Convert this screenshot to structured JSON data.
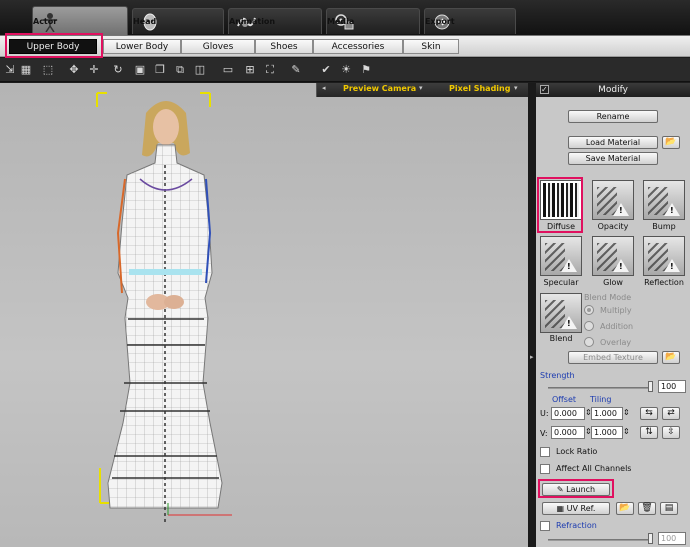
{
  "main_tabs": [
    {
      "label": "Actor",
      "icon": "actor-figure-icon",
      "active": true
    },
    {
      "label": "Head",
      "icon": "head-icon"
    },
    {
      "label": "Animation",
      "icon": "animation-icon"
    },
    {
      "label": "Media",
      "icon": "media-icon"
    },
    {
      "label": "Export",
      "icon": "export-icon"
    }
  ],
  "sub_tabs": [
    {
      "label": "Upper Body",
      "active": true
    },
    {
      "label": "Lower Body"
    },
    {
      "label": "Gloves"
    },
    {
      "label": "Shoes"
    },
    {
      "label": "Accessories"
    },
    {
      "label": "Skin"
    }
  ],
  "viewport": {
    "camera": "Preview Camera",
    "shading": "Pixel Shading"
  },
  "panel": {
    "title": "Modify",
    "rename": "Rename",
    "load_material": "Load Material",
    "save_material": "Save Material",
    "channels": [
      "Diffuse",
      "Opacity",
      "Bump",
      "Specular",
      "Glow",
      "Reflection",
      "Blend"
    ],
    "blend_mode_label": "Blend Mode",
    "blend_modes": [
      "Multiply",
      "Addition",
      "Overlay"
    ],
    "embed_texture": "Embed Texture",
    "strength_label": "Strength",
    "strength_value": "100",
    "offset_label": "Offset",
    "tiling_label": "Tiling",
    "u_label": "U:",
    "v_label": "V:",
    "u_offset": "0.000",
    "u_tiling": "1.000",
    "v_offset": "0.000",
    "v_tiling": "1.000",
    "lock_ratio": "Lock Ratio",
    "affect_all": "Affect All Channels",
    "launch": "Launch",
    "uv_ref": "UV Ref.",
    "refraction": "Refraction",
    "refraction_value": "100"
  },
  "colors": {
    "highlight": "#e0105f",
    "viewport_label": "#f0c800",
    "section_blue": "#1d3cb0"
  }
}
